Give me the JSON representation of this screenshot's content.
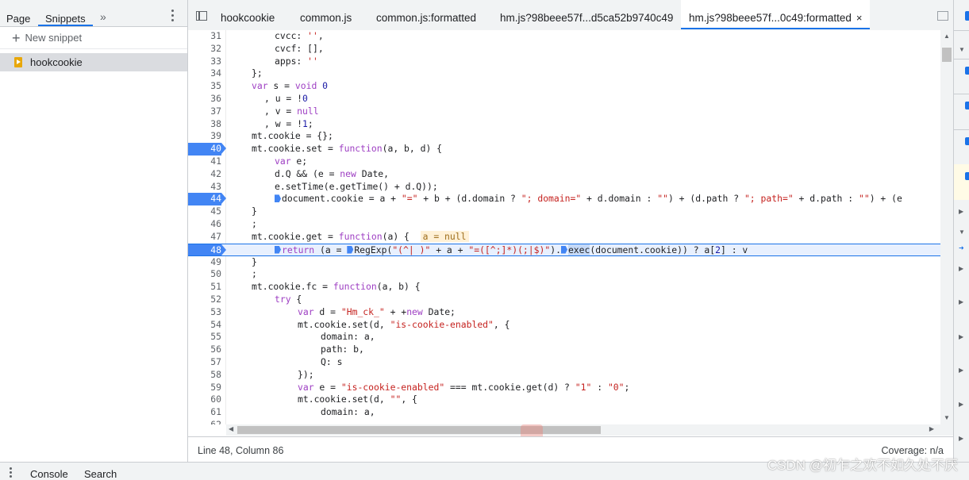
{
  "navigator": {
    "tabs": [
      "Page",
      "Snippets"
    ],
    "more": "»",
    "new_snippet": "New snippet",
    "snippets": [
      "hookcookie"
    ]
  },
  "editor_tabs": [
    "hookcookie",
    "common.js",
    "common.js:formatted",
    "hm.js?98beee57f...d5ca52b9740c49",
    "hm.js?98beee57f...0c49:formatted"
  ],
  "active_tab_close": "×",
  "inline_value": "a = null",
  "status": {
    "position": "Line 48, Column 86",
    "coverage": "Coverage: n/a"
  },
  "drawer": {
    "tabs": [
      "Console",
      "Search"
    ]
  },
  "watermark": "CSDN @初乍之欢不如久处不厌",
  "breakpoints": [
    40,
    44,
    48
  ],
  "current_line": 48,
  "colors": {
    "accent": "#1a73e8",
    "breakpoint": "#4285f4",
    "keyword": "#9e3fc3",
    "string": "#c5221f"
  }
}
